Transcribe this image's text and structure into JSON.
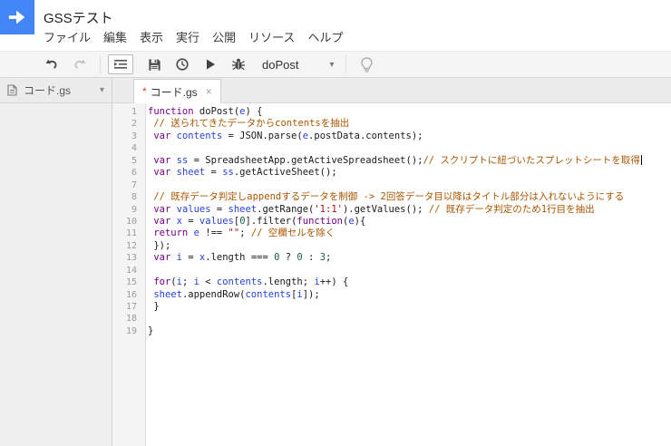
{
  "header": {
    "title": "GSSテスト",
    "menu": [
      "ファイル",
      "編集",
      "表示",
      "実行",
      "公開",
      "リソース",
      "ヘルプ"
    ]
  },
  "toolbar": {
    "icons": [
      "undo",
      "redo",
      "indent",
      "save",
      "triggers-clock",
      "run",
      "debug",
      "hint-bulb"
    ],
    "function_selector_value": "doPost",
    "dropdown_caret": "▾"
  },
  "sidebar": {
    "file_label": "コード.gs",
    "caret": "▾"
  },
  "editor": {
    "tab": {
      "dirty_marker": "*",
      "label": "コード.gs",
      "close": "×"
    },
    "lines": [
      {
        "n": 1,
        "tokens": [
          [
            "k",
            "function"
          ],
          [
            "p",
            " doPost("
          ],
          [
            "v",
            "e"
          ],
          [
            "p",
            ") {"
          ]
        ]
      },
      {
        "n": 2,
        "tokens": [
          [
            "c",
            " // 送られてきたデータからcontentsを抽出"
          ]
        ]
      },
      {
        "n": 3,
        "tokens": [
          [
            "p",
            " "
          ],
          [
            "k",
            "var"
          ],
          [
            "p",
            " "
          ],
          [
            "v",
            "contents"
          ],
          [
            "p",
            " = JSON.parse("
          ],
          [
            "v",
            "e"
          ],
          [
            "p",
            ".postData.contents);"
          ]
        ]
      },
      {
        "n": 4,
        "tokens": []
      },
      {
        "n": 5,
        "tokens": [
          [
            "p",
            " "
          ],
          [
            "k",
            "var"
          ],
          [
            "p",
            " "
          ],
          [
            "v",
            "ss"
          ],
          [
            "p",
            " = SpreadsheetApp.getActiveSpreadsheet();"
          ],
          [
            "c",
            "// スクリプトに紐づいたスプレットシートを取得"
          ],
          [
            "caret",
            ""
          ]
        ]
      },
      {
        "n": 6,
        "tokens": [
          [
            "p",
            " "
          ],
          [
            "k",
            "var"
          ],
          [
            "p",
            " "
          ],
          [
            "v",
            "sheet"
          ],
          [
            "p",
            " = "
          ],
          [
            "v",
            "ss"
          ],
          [
            "p",
            ".getActiveSheet();"
          ]
        ]
      },
      {
        "n": 7,
        "tokens": []
      },
      {
        "n": 8,
        "tokens": [
          [
            "c",
            " // 既存データ判定しappendするデータを制御 -> 2回答データ目以降はタイトル部分は入れないようにする"
          ]
        ]
      },
      {
        "n": 9,
        "tokens": [
          [
            "p",
            " "
          ],
          [
            "k",
            "var"
          ],
          [
            "p",
            " "
          ],
          [
            "v",
            "values"
          ],
          [
            "p",
            " = "
          ],
          [
            "v",
            "sheet"
          ],
          [
            "p",
            ".getRange("
          ],
          [
            "s",
            "'1:1'"
          ],
          [
            "p",
            ").getValues(); "
          ],
          [
            "c",
            "// 既存データ判定のため1行目を抽出"
          ]
        ]
      },
      {
        "n": 10,
        "tokens": [
          [
            "p",
            " "
          ],
          [
            "k",
            "var"
          ],
          [
            "p",
            " "
          ],
          [
            "v",
            "x"
          ],
          [
            "p",
            " = "
          ],
          [
            "v",
            "values"
          ],
          [
            "p",
            "["
          ],
          [
            "n",
            "0"
          ],
          [
            "p",
            "].filter("
          ],
          [
            "k",
            "function"
          ],
          [
            "p",
            "("
          ],
          [
            "v",
            "e"
          ],
          [
            "p",
            "){"
          ]
        ]
      },
      {
        "n": 11,
        "tokens": [
          [
            "p",
            " "
          ],
          [
            "k",
            "return"
          ],
          [
            "p",
            " "
          ],
          [
            "v",
            "e"
          ],
          [
            "p",
            " !== "
          ],
          [
            "s",
            "\"\""
          ],
          [
            "p",
            "; "
          ],
          [
            "c",
            "// 空欄セルを除く"
          ]
        ]
      },
      {
        "n": 12,
        "tokens": [
          [
            "p",
            " });"
          ]
        ]
      },
      {
        "n": 13,
        "tokens": [
          [
            "p",
            " "
          ],
          [
            "k",
            "var"
          ],
          [
            "p",
            " "
          ],
          [
            "v",
            "i"
          ],
          [
            "p",
            " = "
          ],
          [
            "v",
            "x"
          ],
          [
            "p",
            ".length === "
          ],
          [
            "n",
            "0"
          ],
          [
            "p",
            " ? "
          ],
          [
            "n",
            "0"
          ],
          [
            "p",
            " : "
          ],
          [
            "n",
            "3"
          ],
          [
            "p",
            ";"
          ]
        ]
      },
      {
        "n": 14,
        "tokens": []
      },
      {
        "n": 15,
        "tokens": [
          [
            "p",
            " "
          ],
          [
            "k",
            "for"
          ],
          [
            "p",
            "("
          ],
          [
            "v",
            "i"
          ],
          [
            "p",
            "; "
          ],
          [
            "v",
            "i"
          ],
          [
            "p",
            " < "
          ],
          [
            "v",
            "contents"
          ],
          [
            "p",
            ".length; "
          ],
          [
            "v",
            "i"
          ],
          [
            "p",
            "++) {"
          ]
        ]
      },
      {
        "n": 16,
        "tokens": [
          [
            "p",
            " "
          ],
          [
            "v",
            "sheet"
          ],
          [
            "p",
            ".appendRow("
          ],
          [
            "v",
            "contents"
          ],
          [
            "p",
            "["
          ],
          [
            "v",
            "i"
          ],
          [
            "p",
            "]);"
          ]
        ]
      },
      {
        "n": 17,
        "tokens": [
          [
            "p",
            " }"
          ]
        ]
      },
      {
        "n": 18,
        "tokens": []
      },
      {
        "n": 19,
        "tokens": [
          [
            "p",
            "}"
          ]
        ]
      }
    ]
  },
  "colors": {
    "logo_blue": "#4285f4",
    "keyword": "#770088",
    "variable": "#2840d6",
    "comment": "#aa5500",
    "string": "#aa1111",
    "number": "#116644",
    "dirty_marker": "#d14836"
  }
}
